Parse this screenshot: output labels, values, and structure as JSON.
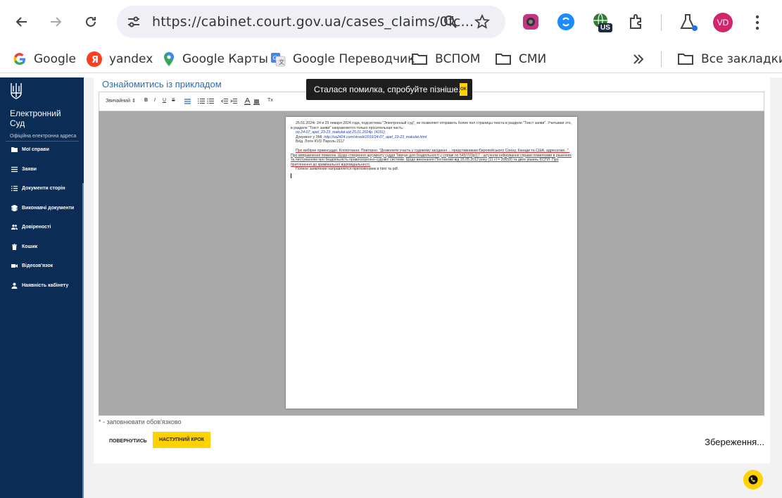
{
  "browser": {
    "url": "https://cabinet.court.gov.ua/cases_claims/0fc...",
    "profile_initials": "VD",
    "extension_badge": "US",
    "bookmarks": [
      {
        "label": "Google",
        "icon": "google-icon"
      },
      {
        "label": "yandex",
        "icon": "yandex-icon"
      },
      {
        "label": "Google Карты",
        "icon": "maps-pin-icon"
      },
      {
        "label": "Google Переводчик",
        "icon": "translate-icon"
      },
      {
        "label": "ВСПОМ",
        "icon": "folder-icon"
      },
      {
        "label": "СМИ",
        "icon": "folder-icon"
      }
    ],
    "all_bookmarks": "Все закладки"
  },
  "sidebar": {
    "title_line1": "Електронний",
    "title_line2": "Суд",
    "subtitle": "Офіційна електронна адреса",
    "items": [
      {
        "label": "Мої справи",
        "icon": "folder-icon"
      },
      {
        "label": "Заяви",
        "icon": "list-icon"
      },
      {
        "label": "Документи сторін",
        "icon": "checklist-icon"
      },
      {
        "label": "Виконавчі документи",
        "icon": "layers-icon"
      },
      {
        "label": "Довіреності",
        "icon": "people-icon"
      },
      {
        "label": "Кошик",
        "icon": "trash-icon"
      },
      {
        "label": "Відеозв'язок",
        "icon": "video-icon"
      },
      {
        "label": "Наявність кабінету",
        "icon": "person-icon"
      }
    ]
  },
  "main": {
    "example_link": "Ознайомитись із прикладом",
    "toolbar": {
      "format": "Звичайний",
      "bold": "B",
      "italic": "I",
      "underline": "U",
      "strike": "S",
      "clear": "Tx"
    },
    "document": {
      "p1": "25.01.2024г. 24 и 25 января 2024 года, подсистема \"Электронный суд\", не позволяет отправить более пол страницы текста в разделе \"Текст заяви\". Учитывая это, в разделе \"Текст заяви\" направляется только просительная часть:",
      "p2": "по 24-07_apel_23-23_makulat.ejd 25.01.2024р. (4151)",
      "p3_prefix": "Документ у ЗМІ: ",
      "p3_link": "http://ua2424.com/strasb/2016/24-07_apel_23-23_makulat.html",
      "p4": "Вхід. Логін KVD Пароль:2117",
      "p5": "Про вибірне правосуддя. Клопотання. Повторно. \"Дозволити участь у судовому засіданні ... представникам Європейського Союзу, Канади та США, адресатам...\". Про виправлення помилок. Щодо створення аргументу суддя Тимчук для бездіяльності у справі по 545/703р/17 - штучном інфікування справи помилками в рішеннях та листуванням про бездіяльність правоохоронно-судової системи. Щодо виконання Постанови від 15.05.2012 року (11 сl = 20659) та двох рішень ЄСПЛ. Про притягнення до кримінальної відповідальності.",
      "p6": "Полное заявление направляется приложением в html та pdf."
    },
    "required_note": "* - заповнювати обов'язково",
    "back_button": "ПОВЕРНУТИСЬ",
    "next_button": "НАСТУПНИЙ КРОК",
    "saving": "Збереження..."
  },
  "toast": {
    "message": "Сталася помилка, спробуйте пізніше.",
    "ok": "OK"
  },
  "colors": {
    "sidebar_bg": "#0b2d55",
    "accent_yellow": "#ffd200",
    "link_blue": "#2a6db5"
  }
}
